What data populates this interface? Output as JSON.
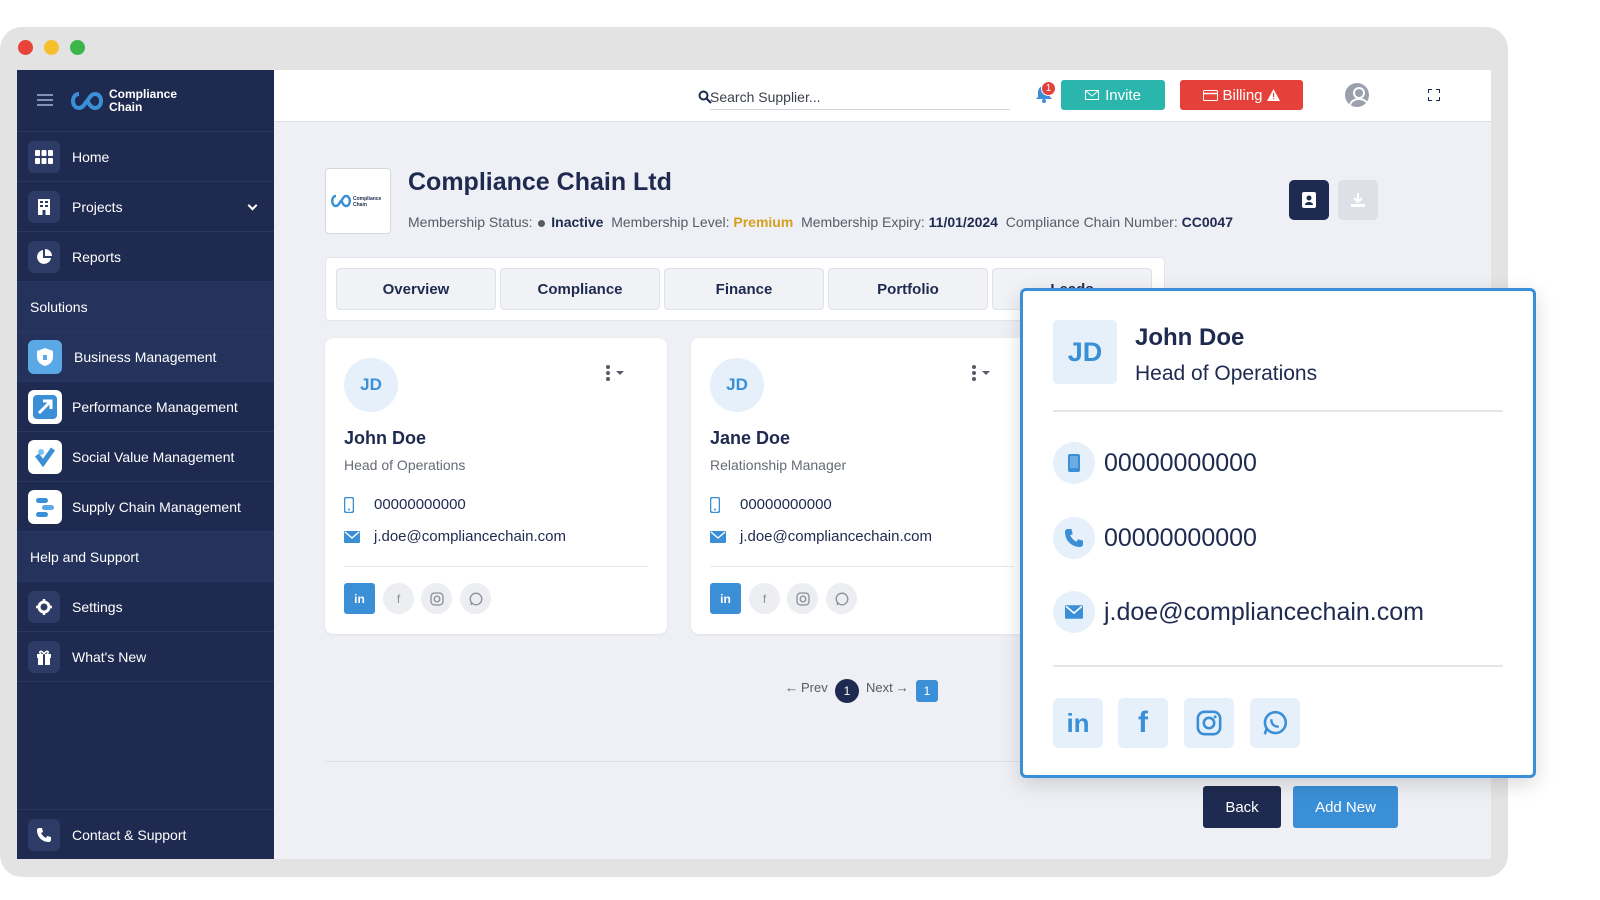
{
  "app": {
    "logo_line1": "Compliance",
    "logo_line2": "Chain"
  },
  "window": {
    "colors": {
      "close": "#e8443a",
      "minimize": "#f5c02b",
      "maximize": "#3cb54a"
    }
  },
  "sidebar": {
    "items": [
      {
        "label": "Home",
        "icon": "grid-icon"
      },
      {
        "label": "Projects",
        "icon": "building-icon"
      },
      {
        "label": "Reports",
        "icon": "pie-chart-icon"
      }
    ],
    "solutions_label": "Solutions",
    "solutions": [
      {
        "label": "Business Management",
        "icon": "shield-app-icon"
      },
      {
        "label": "Performance Management",
        "icon": "arrow-app-icon"
      },
      {
        "label": "Social Value Management",
        "icon": "heart-app-icon"
      },
      {
        "label": "Supply Chain Management",
        "icon": "chain-app-icon"
      }
    ],
    "help_label": "Help and Support",
    "help": [
      {
        "label": "Settings",
        "icon": "gear-icon"
      },
      {
        "label": "What's New",
        "icon": "gift-icon"
      }
    ],
    "contact_label": "Contact & Support"
  },
  "topbar": {
    "search_placeholder": "Search Supplier...",
    "notification_count": "1",
    "invite_label": "Invite",
    "billing_label": "Billing",
    "colors": {
      "invite": "#2bb6ad",
      "billing": "#e5413a"
    }
  },
  "company": {
    "name": "Compliance Chain Ltd",
    "membership_status_label": "Membership Status:",
    "membership_status": "Inactive",
    "membership_level_label": "Membership Level:",
    "membership_level": "Premium",
    "membership_expiry_label": "Membership Expiry:",
    "membership_expiry": "11/01/2024",
    "number_label": "Compliance Chain Number:",
    "number": "CC0047"
  },
  "tabs": [
    "Overview",
    "Compliance",
    "Finance",
    "Portfolio",
    "Leads"
  ],
  "contacts": [
    {
      "initials": "JD",
      "name": "John Doe",
      "role": "Head of Operations",
      "phone": "00000000000",
      "email": "j.doe@compliancechain.com"
    },
    {
      "initials": "JD",
      "name": "Jane Doe",
      "role": "Relationship Manager",
      "phone": "00000000000",
      "email": "j.doe@compliancechain.com"
    }
  ],
  "social": {
    "linkedin": "in",
    "facebook": "f"
  },
  "pagination": {
    "prev": "Prev",
    "current": "1",
    "next": "Next",
    "total": "1"
  },
  "actions": {
    "back": "Back",
    "add_new": "Add New"
  },
  "popup": {
    "initials": "JD",
    "name": "John Doe",
    "role": "Head of Operations",
    "mobile": "00000000000",
    "phone": "00000000000",
    "email": "j.doe@compliancechain.com"
  },
  "colors": {
    "navy": "#1e2a4f",
    "accent": "#3a8fd6",
    "premium": "#d4a020"
  }
}
